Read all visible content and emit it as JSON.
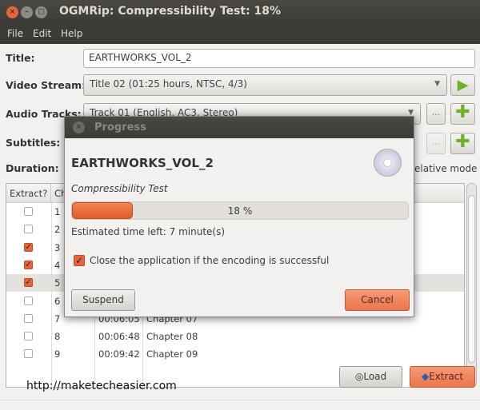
{
  "window": {
    "title": "OGMRip: Compressibility Test: 18%"
  },
  "menu": [
    "File",
    "Edit",
    "Help"
  ],
  "form": {
    "title_label": "Title:",
    "title_value": "EARTHWORKS_VOL_2",
    "video_label": "Video Stream:",
    "video_value": "Title 02 (01:25 hours, NTSC, 4/3)",
    "audio_label": "Audio Tracks:",
    "audio_value": "Track 01 (English, AC3, Stereo)",
    "subtitles_label": "Subtitles:",
    "duration_label": "Duration:",
    "relative_mode": "elative mode",
    "more_label": "..."
  },
  "table": {
    "headers": [
      "Extract?",
      "Ch"
    ],
    "rows": [
      {
        "n": "1",
        "checked": false,
        "time": "",
        "name": ""
      },
      {
        "n": "2",
        "checked": false,
        "time": "",
        "name": ""
      },
      {
        "n": "3",
        "checked": true,
        "time": "",
        "name": ""
      },
      {
        "n": "4",
        "checked": true,
        "time": "",
        "name": ""
      },
      {
        "n": "5",
        "checked": true,
        "time": "",
        "name": "",
        "selected": true
      },
      {
        "n": "6",
        "checked": false,
        "time": "",
        "name": ""
      },
      {
        "n": "7",
        "checked": false,
        "time": "00:06:05",
        "name": "Chapter 07"
      },
      {
        "n": "8",
        "checked": false,
        "time": "00:06:48",
        "name": "Chapter 08"
      },
      {
        "n": "9",
        "checked": false,
        "time": "00:09:42",
        "name": "Chapter 09"
      }
    ]
  },
  "buttons": {
    "load": "Load",
    "extract": "Extract"
  },
  "watermark": "http://maketecheasier.com",
  "dialog": {
    "title": "Progress",
    "heading": "EARTHWORKS_VOL_2",
    "stage": "Compressibility Test",
    "progress_percent": 18,
    "progress_label": "18 %",
    "eta": "Estimated time left:  7 minute(s)",
    "close_option": "Close the application if the encoding is successful",
    "close_checked": true,
    "suspend": "Suspend",
    "cancel": "Cancel"
  },
  "colors": {
    "accent": "#e9754b",
    "titlebar": "#3c3b37",
    "close": "#e9663b"
  }
}
